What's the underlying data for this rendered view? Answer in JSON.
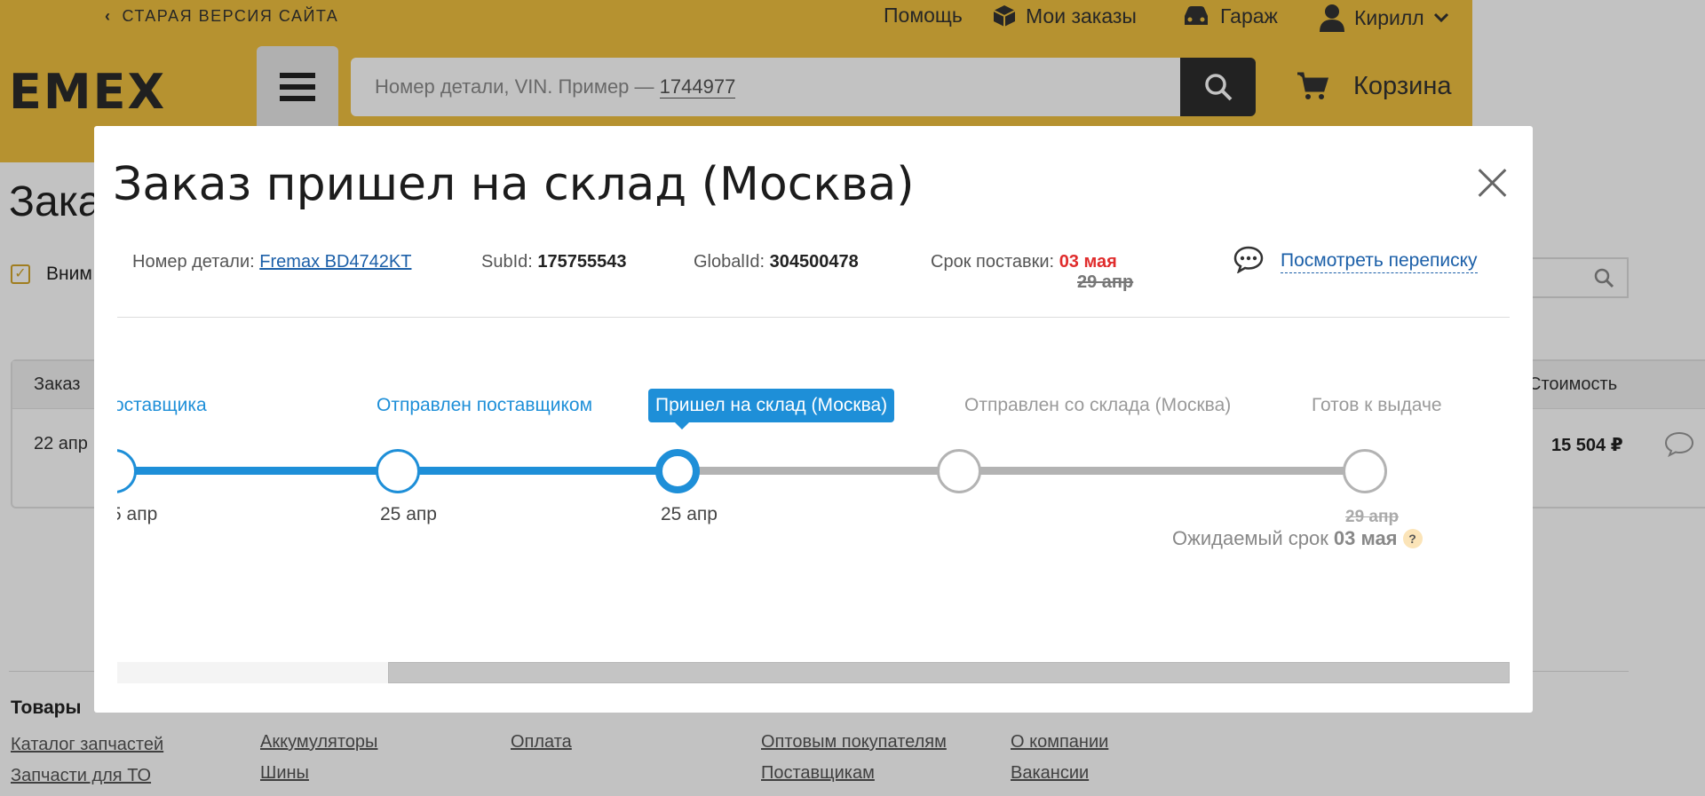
{
  "header": {
    "old_site": "СТАРАЯ ВЕРСИЯ САЙТА",
    "help": "Помощь",
    "orders": "Мои заказы",
    "garage": "Гараж",
    "user": "Кирилл",
    "logo": "EMEX",
    "search_placeholder": "Номер детали, VIN. Пример — ",
    "search_example": "1744977",
    "cart": "Корзина",
    "accent_color": "#f0c040"
  },
  "page": {
    "title": "Зака",
    "notice": "Вним",
    "table_head_order": "Заказ",
    "table_head_cost": "Стоимость",
    "row_date": "22 апр",
    "row_price": "15 504 ₽"
  },
  "footer": {
    "col1_title": "Товары",
    "col1_links": [
      "Каталог запчастей",
      "Запчасти для ТО"
    ],
    "col2_links": [
      "Аккумуляторы",
      "Шины"
    ],
    "col3_links": [
      "Оплата"
    ],
    "col4_links": [
      "Оптовым покупателям",
      "Поставщикам"
    ],
    "col5_links": [
      "О компании",
      "Вакансии"
    ]
  },
  "modal": {
    "title": "Заказ пришел на склад (Москва)",
    "part_label": "Номер детали:",
    "part_value": "Fremax BD4742KT",
    "subid_label": "SubId:",
    "subid_value": "175755543",
    "globalid_label": "GlobalId:",
    "globalid_value": "304500478",
    "deadline_label": "Срок поставки:",
    "deadline_new": "03 мая",
    "deadline_old": "29 апр",
    "chat_link": "Посмотреть переписку",
    "timeline": {
      "steps": [
        {
          "label": "оставщика",
          "date": "5 апр",
          "state": "done"
        },
        {
          "label": "Отправлен поставщиком",
          "date": "25 апр",
          "state": "done"
        },
        {
          "label": "Пришел на склад (Москва)",
          "date": "25 апр",
          "state": "current"
        },
        {
          "label": "Отправлен со склада (Москва)",
          "date": "",
          "state": "pending"
        },
        {
          "label": "Готов к выдаче",
          "date": "29 апр",
          "state": "pending"
        }
      ],
      "expected_label": "Ожидаемый срок",
      "expected_value": "03 мая",
      "help_glyph": "?"
    },
    "accent_color": "#1e8fd8"
  }
}
